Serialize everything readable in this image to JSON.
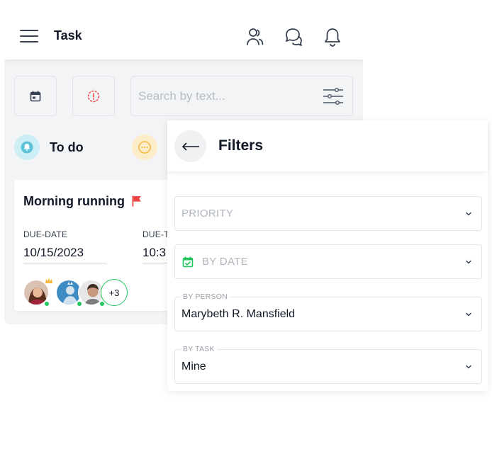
{
  "header": {
    "title": "Task",
    "icons": [
      "menu-icon",
      "users-icon",
      "chat-icon",
      "bell-icon"
    ]
  },
  "toolbar": {
    "calendar_icon": "calendar-icon",
    "priority_icon": "alert-circle-icon",
    "search_placeholder": "Search by text...",
    "filter_icon": "sliders-icon"
  },
  "columns": [
    {
      "title": "To do",
      "icon": "bell-icon",
      "color": "#67c5dc"
    },
    {
      "title": "",
      "icon": "ellipsis-icon",
      "color": "#f5b942"
    }
  ],
  "task_card": {
    "title": "Morning running",
    "flag_color": "#ef4444",
    "due_date_label": "DUE-DATE",
    "due_date": "10/15/2023",
    "due_time_label": "DUE-T",
    "due_time": "10:3",
    "extra_assignees": "+3"
  },
  "filters": {
    "title": "Filters",
    "priority_placeholder": "PRIORITY",
    "by_date_placeholder": "BY DATE",
    "by_person_label": "BY PERSON",
    "by_person_value": "Marybeth R. Mansfield",
    "by_task_label": "BY TASK",
    "by_task_value": "Mine"
  },
  "colors": {
    "accent_green": "#22c55e",
    "flag_red": "#ef4444",
    "panel_bg": "#f3f4f6"
  }
}
